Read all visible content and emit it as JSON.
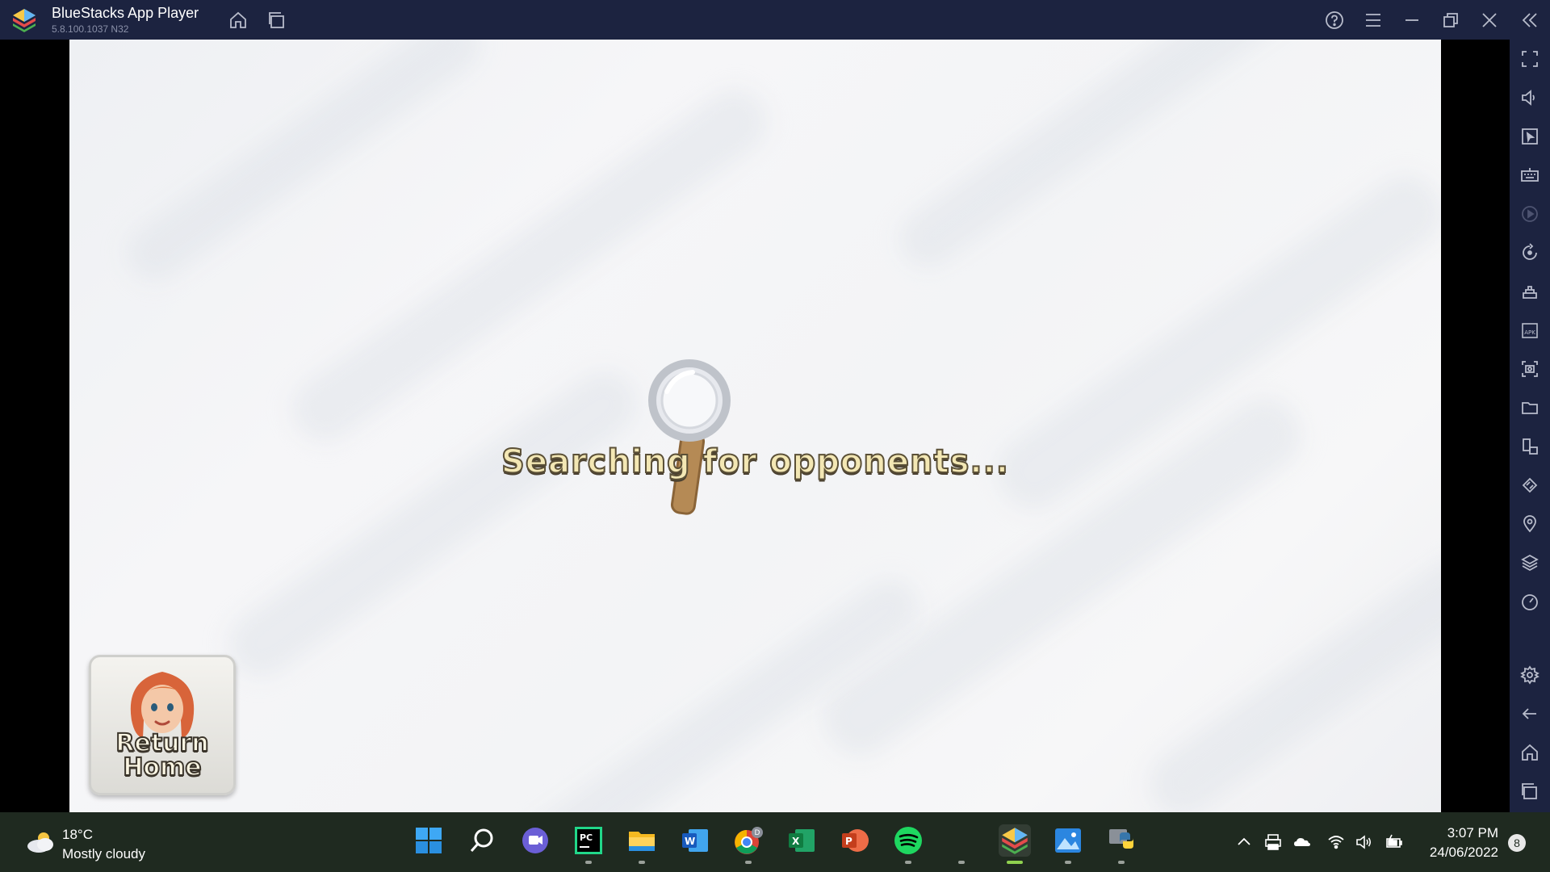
{
  "window": {
    "title": "BlueStacks App Player",
    "version": "5.8.100.1037  N32"
  },
  "game": {
    "status_text": "Searching for opponents...",
    "return_button_label": "Return Home"
  },
  "sidebar_icons": [
    "fullscreen-icon",
    "volume-icon",
    "pointer-icon",
    "keyboard-icon",
    "macro-record-icon",
    "rotate-icon",
    "shake-icon",
    "install-apk-icon",
    "screenshot-icon",
    "folder-icon",
    "multi-instance-icon",
    "eco-mode-icon",
    "location-icon",
    "layers-icon",
    "speed-icon",
    "settings-icon",
    "back-icon",
    "home-icon",
    "recent-apps-icon"
  ],
  "taskbar": {
    "weather_temp": "18°C",
    "weather_condition": "Mostly cloudy",
    "time": "3:07 PM",
    "date": "24/06/2022",
    "notification_count": "8",
    "apps": [
      "start",
      "search",
      "teams",
      "pycharm",
      "file-explorer",
      "word",
      "chrome",
      "excel",
      "powerpoint",
      "spotify",
      "bluestacks",
      "photos",
      "python"
    ],
    "active_app": "bluestacks",
    "chrome_profile_letter": "D"
  },
  "colors": {
    "titlebar": "#1c2340",
    "taskbar": "#1f2a20",
    "accent_green": "#8fd14f"
  }
}
